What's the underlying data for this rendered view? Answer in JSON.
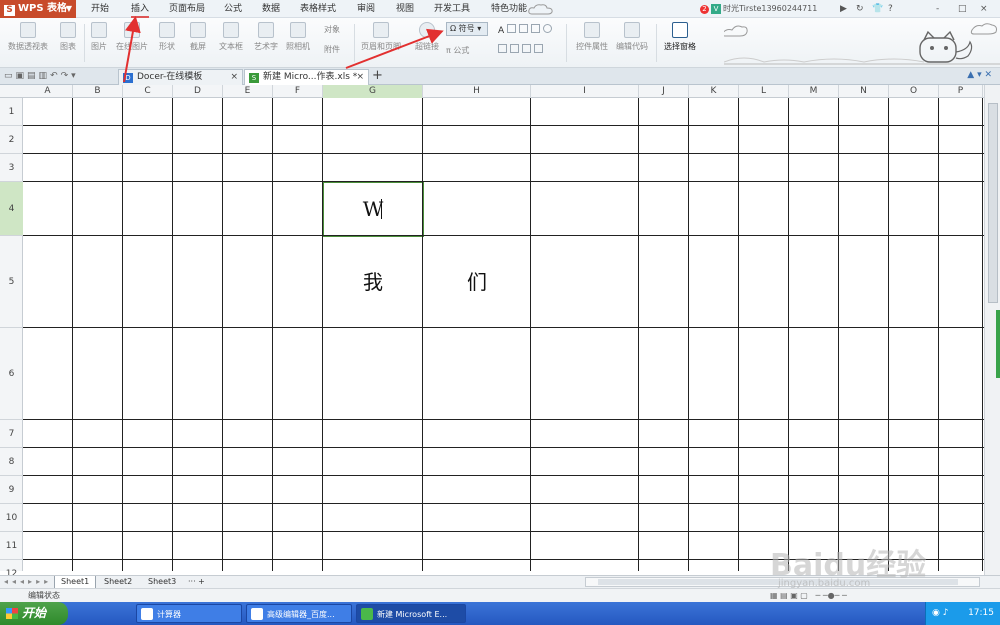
{
  "app": {
    "name": "WPS 表格",
    "logo_letter": "S"
  },
  "menu": {
    "tabs": [
      "开始",
      "插入",
      "页面布局",
      "公式",
      "数据",
      "表格样式",
      "审阅",
      "视图",
      "开发工具",
      "特色功能"
    ],
    "active_tab": "插入"
  },
  "user": {
    "notification_count": "2",
    "name": "时光Tirste13960244711",
    "controls": [
      "?",
      "-",
      "□",
      "×"
    ]
  },
  "ribbon": {
    "buttons": [
      "数据透视表",
      "图表",
      "图片",
      "在线图片",
      "形状",
      "截屏",
      "文本框",
      "艺术字",
      "照相机",
      "对象",
      "附件",
      "页眉和页脚",
      "超链接",
      "控件属性",
      "编辑代码",
      "选择窗格"
    ],
    "symbol_label": "符号",
    "formula_label": "公式"
  },
  "tabs": {
    "docer": "Docer-在线模板",
    "file": "新建 Micro...作表.xls *"
  },
  "columns": [
    "A",
    "B",
    "C",
    "D",
    "E",
    "F",
    "G",
    "H",
    "I",
    "J",
    "K",
    "L",
    "M",
    "N",
    "O",
    "P"
  ],
  "rows": [
    "1",
    "2",
    "3",
    "4",
    "5",
    "6",
    "7",
    "8",
    "9",
    "10",
    "11",
    "12"
  ],
  "selection": {
    "column": "G",
    "row": "4"
  },
  "cells": {
    "G4": "W",
    "G5": "我",
    "H5": "们"
  },
  "sheets": [
    "Sheet1",
    "Sheet2",
    "Sheet3"
  ],
  "active_sheet": "Sheet1",
  "status": {
    "text": "编辑状态"
  },
  "taskbar": {
    "start": "开始",
    "items": [
      "计算器",
      "高级编辑器_百度...",
      "新建 Microsoft E..."
    ],
    "clock": "17:15"
  },
  "watermark": {
    "main": "Baidu经验",
    "sub": "jingyan.baidu.com"
  }
}
